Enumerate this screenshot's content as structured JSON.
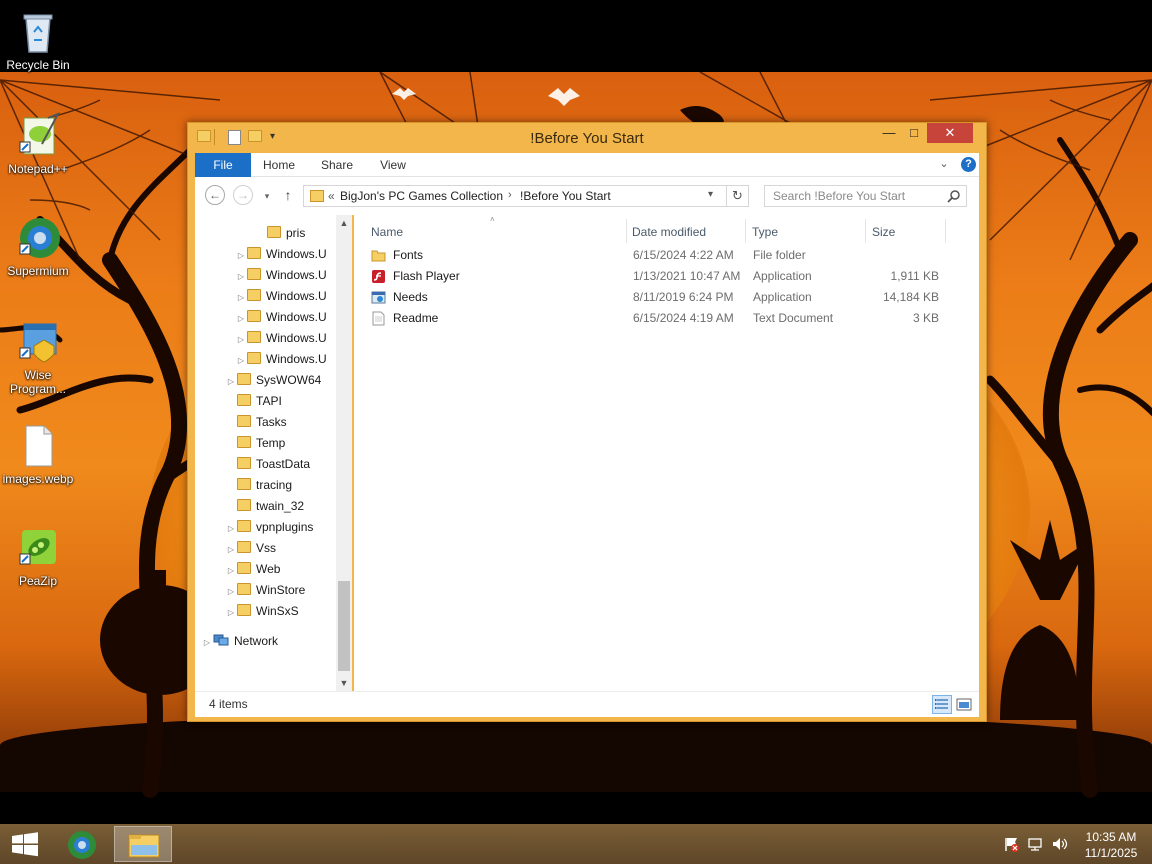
{
  "desktop": {
    "icons": [
      {
        "label": "Recycle Bin"
      },
      {
        "label": "Notepad++"
      },
      {
        "label": "Supermium"
      },
      {
        "label": "Wise Program..."
      },
      {
        "label": "images.webp"
      },
      {
        "label": "PeaZip"
      }
    ]
  },
  "window": {
    "title": "!Before You Start",
    "ribbon": {
      "file": "File",
      "home": "Home",
      "share": "Share",
      "view": "View"
    },
    "address": {
      "prefix": "«",
      "crumbs": [
        "BigJon's PC Games Collection",
        "!Before You Start"
      ],
      "separator": "›"
    },
    "search": {
      "placeholder": "Search !Before You Start"
    },
    "tree": [
      {
        "label": "pris",
        "expandable": false
      },
      {
        "label": "Windows.U",
        "expandable": true
      },
      {
        "label": "Windows.U",
        "expandable": true
      },
      {
        "label": "Windows.U",
        "expandable": true
      },
      {
        "label": "Windows.U",
        "expandable": true
      },
      {
        "label": "Windows.U",
        "expandable": true
      },
      {
        "label": "Windows.U",
        "expandable": true
      },
      {
        "label": "SysWOW64",
        "expandable": true
      },
      {
        "label": "TAPI",
        "expandable": false
      },
      {
        "label": "Tasks",
        "expandable": false
      },
      {
        "label": "Temp",
        "expandable": false
      },
      {
        "label": "ToastData",
        "expandable": false
      },
      {
        "label": "tracing",
        "expandable": false
      },
      {
        "label": "twain_32",
        "expandable": false
      },
      {
        "label": "vpnplugins",
        "expandable": true
      },
      {
        "label": "Vss",
        "expandable": true
      },
      {
        "label": "Web",
        "expandable": true
      },
      {
        "label": "WinStore",
        "expandable": true
      },
      {
        "label": "WinSxS",
        "expandable": true
      }
    ],
    "network_label": "Network",
    "columns": {
      "name": "Name",
      "date": "Date modified",
      "type": "Type",
      "size": "Size"
    },
    "files": [
      {
        "name": "Fonts",
        "date": "6/15/2024 4:22 AM",
        "type": "File folder",
        "size": "",
        "icon": "folder-icon"
      },
      {
        "name": "Flash Player",
        "date": "1/13/2021 10:47 AM",
        "type": "Application",
        "size": "1,911 KB",
        "icon": "flash-player-icon"
      },
      {
        "name": "Needs",
        "date": "8/11/2019 6:24 PM",
        "type": "Application",
        "size": "14,184 KB",
        "icon": "application-icon"
      },
      {
        "name": "Readme",
        "date": "6/15/2024 4:19 AM",
        "type": "Text Document",
        "size": "3 KB",
        "icon": "text-document-icon"
      }
    ],
    "status": "4 items"
  },
  "taskbar": {
    "time": "10:35 AM",
    "date": "11/1/2025"
  },
  "colors": {
    "window_frame": "#f3b64a",
    "file_tab": "#1b6fc7",
    "close_button": "#c7443a",
    "taskbar": "#6b5230"
  }
}
